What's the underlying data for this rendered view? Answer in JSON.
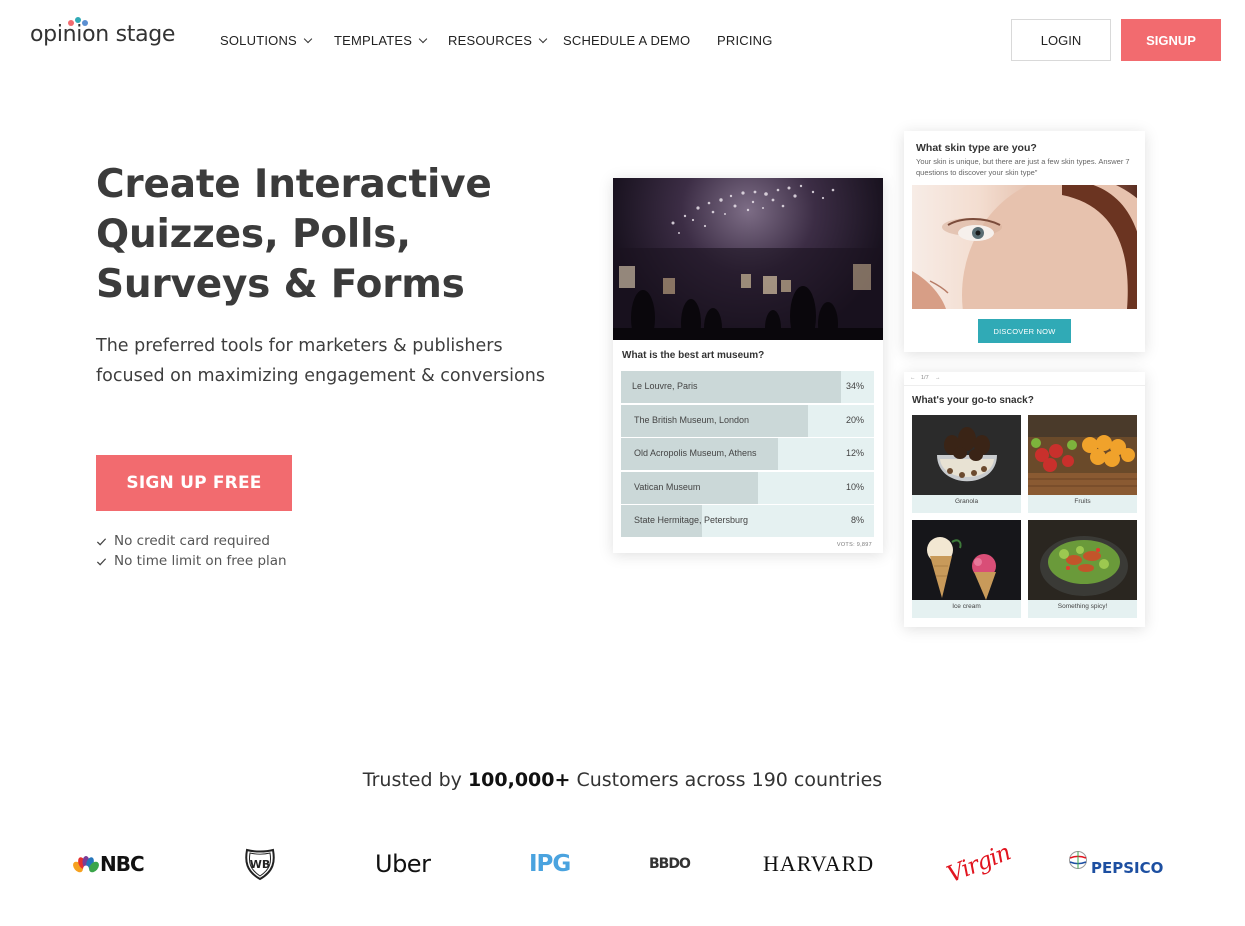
{
  "brand": {
    "name": "opinion stage"
  },
  "nav": {
    "items": [
      {
        "label": "SOLUTIONS",
        "has_dropdown": true
      },
      {
        "label": "TEMPLATES",
        "has_dropdown": true
      },
      {
        "label": "RESOURCES",
        "has_dropdown": true
      },
      {
        "label": "SCHEDULE A DEMO",
        "has_dropdown": false
      },
      {
        "label": "PRICING",
        "has_dropdown": false
      }
    ],
    "login_label": "LOGIN",
    "signup_label": "SIGNUP"
  },
  "hero": {
    "title_lines": [
      "Create Interactive",
      "Quizzes, Polls,",
      "Surveys & Forms"
    ],
    "subtitle_lines": [
      "The preferred tools for marketers & publishers",
      "focused on maximizing engagement & conversions"
    ],
    "cta_label": "SIGN UP FREE",
    "checks": [
      "No credit card required",
      "No time limit on free plan"
    ]
  },
  "poll_card": {
    "question": "What is the best art museum?",
    "options": [
      {
        "label": "Le Louvre, Paris",
        "percent_label": "34%",
        "share": 0.87
      },
      {
        "label": "The British Museum, London",
        "percent_label": "20%",
        "share": 0.74
      },
      {
        "label": "Old Acropolis Museum, Athens",
        "percent_label": "12%",
        "share": 0.62
      },
      {
        "label": "Vatican Museum",
        "percent_label": "10%",
        "share": 0.54
      },
      {
        "label": "State Hermitage, Petersburg",
        "percent_label": "8%",
        "share": 0.32
      }
    ],
    "votes": "VOTS: 9,897"
  },
  "skin_card": {
    "title": "What  skin type are you?",
    "subtitle": "Your skin is unique, but there are just a few skin types. Answer 7 questions to discover your skin type\"",
    "button_label": "DISCOVER NOW"
  },
  "snack_card": {
    "nav_prev": "←",
    "nav_counter": "1/7",
    "nav_next": "→",
    "question": "What's your go-to snack?",
    "options": [
      "Granola",
      "Fruits",
      "Ice cream",
      "Something spicy!"
    ]
  },
  "trusted": {
    "prefix": "Trusted by ",
    "highlight": "100,000+",
    "suffix": " Customers across 190 countries"
  },
  "customer_logos": [
    "NBC",
    "WB",
    "Uber",
    "IPG",
    "BBDO",
    "HARVARD",
    "Virgin",
    "PEPSICO"
  ],
  "colors": {
    "accent": "#f26b6f",
    "teal": "#30aab6",
    "bar_bg": "#e5f1f1",
    "bar_fill": "#cbd8d8"
  }
}
